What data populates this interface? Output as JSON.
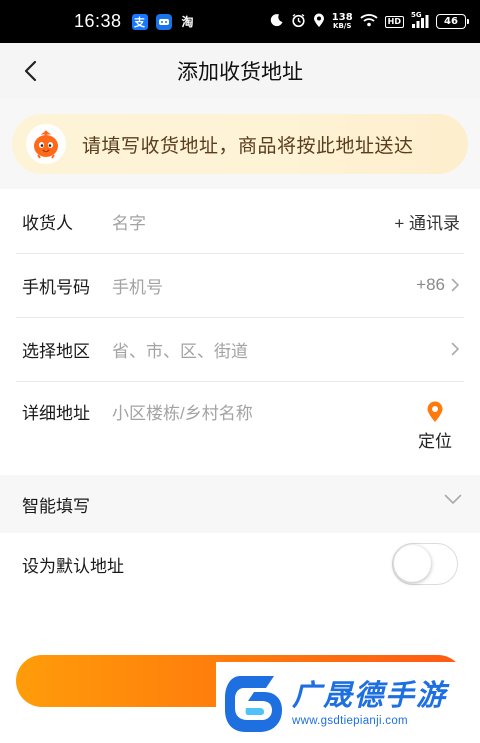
{
  "status_bar": {
    "time": "16:38",
    "apps": [
      "支",
      "淘"
    ],
    "speed_value": "138",
    "speed_unit": "KB/S",
    "hd_badge": "HD",
    "network": "5G",
    "battery": "46"
  },
  "nav": {
    "title": "添加收货地址"
  },
  "notice": {
    "text": "请填写收货地址，商品将按此地址送达"
  },
  "form": {
    "recipient": {
      "label": "收货人",
      "placeholder": "名字",
      "action": "+ 通讯录"
    },
    "phone": {
      "label": "手机号码",
      "placeholder": "手机号",
      "country_code": "+86"
    },
    "region": {
      "label": "选择地区",
      "placeholder": "省、市、区、街道"
    },
    "address": {
      "label": "详细地址",
      "placeholder": "小区楼栋/乡村名称",
      "locate_label": "定位"
    }
  },
  "smart_fill": {
    "label": "智能填写"
  },
  "default_address": {
    "label": "设为默认地址",
    "enabled": false
  },
  "watermark": {
    "title": "广晟德手游",
    "url": "www.gsdtiepianji.com"
  },
  "colors": {
    "accent_orange": "#ff7a0c",
    "notice_bg": "#fef3d5",
    "locate_pin": "#ff7a0c",
    "watermark_blue": "#1e6fe0"
  }
}
